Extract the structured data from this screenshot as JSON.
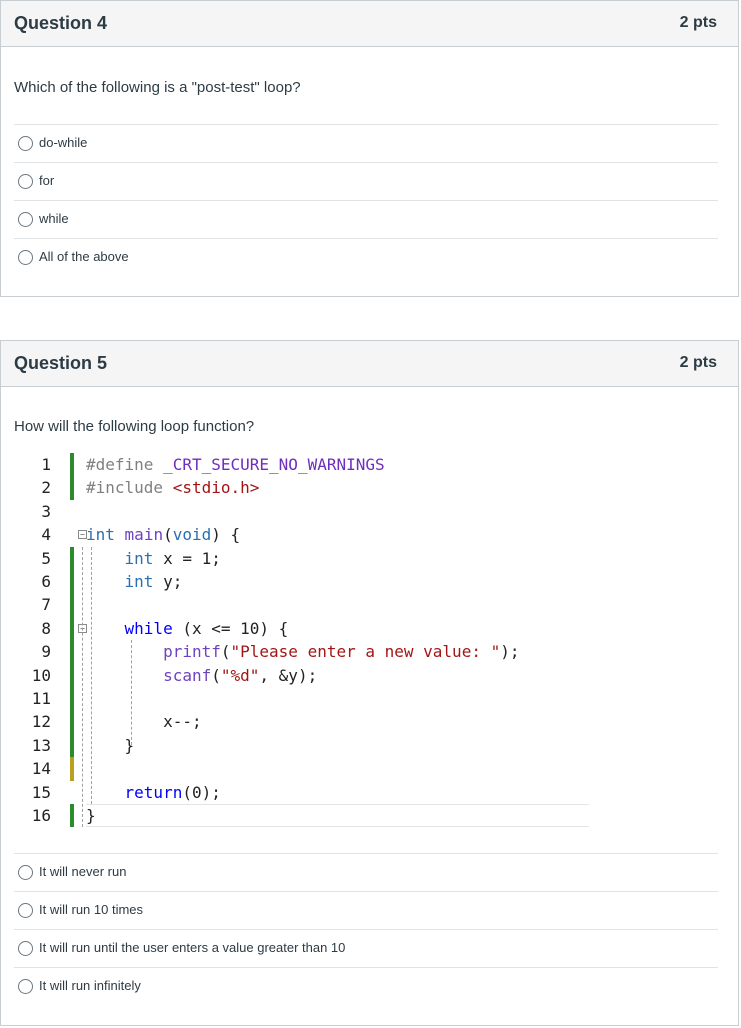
{
  "questions": [
    {
      "title": "Question 4",
      "points": "2 pts",
      "text": "Which of the following is a \"post-test\" loop?",
      "answers": [
        "do-while",
        "for",
        "while",
        "All of the above"
      ]
    },
    {
      "title": "Question 5",
      "points": "2 pts",
      "text": "How will the following loop function?",
      "code": {
        "line_numbers": [
          "1",
          "2",
          "3",
          "4",
          "5",
          "6",
          "7",
          "8",
          "9",
          "10",
          "11",
          "12",
          "13",
          "14",
          "15",
          "16"
        ],
        "lines": [
          "#define _CRT_SECURE_NO_WARNINGS",
          "#include <stdio.h>",
          "",
          "int main(void) {",
          "    int x = 1;",
          "    int y;",
          "",
          "    while (x <= 10) {",
          "        printf(\"Please enter a new value: \");",
          "        scanf(\"%d\", &y);",
          "",
          "        x--;",
          "    }",
          "",
          "    return(0);",
          "}"
        ]
      },
      "answers": [
        "It will never run",
        "It will run 10 times",
        "It will run until the user enters a value greater than 10",
        "It will run infinitely"
      ]
    }
  ],
  "colors": {
    "border": "#c7cdd1",
    "header_bg": "#f5f5f5",
    "change_bar_green": "#2e8a2e",
    "change_bar_yellow": "#b8a020"
  }
}
